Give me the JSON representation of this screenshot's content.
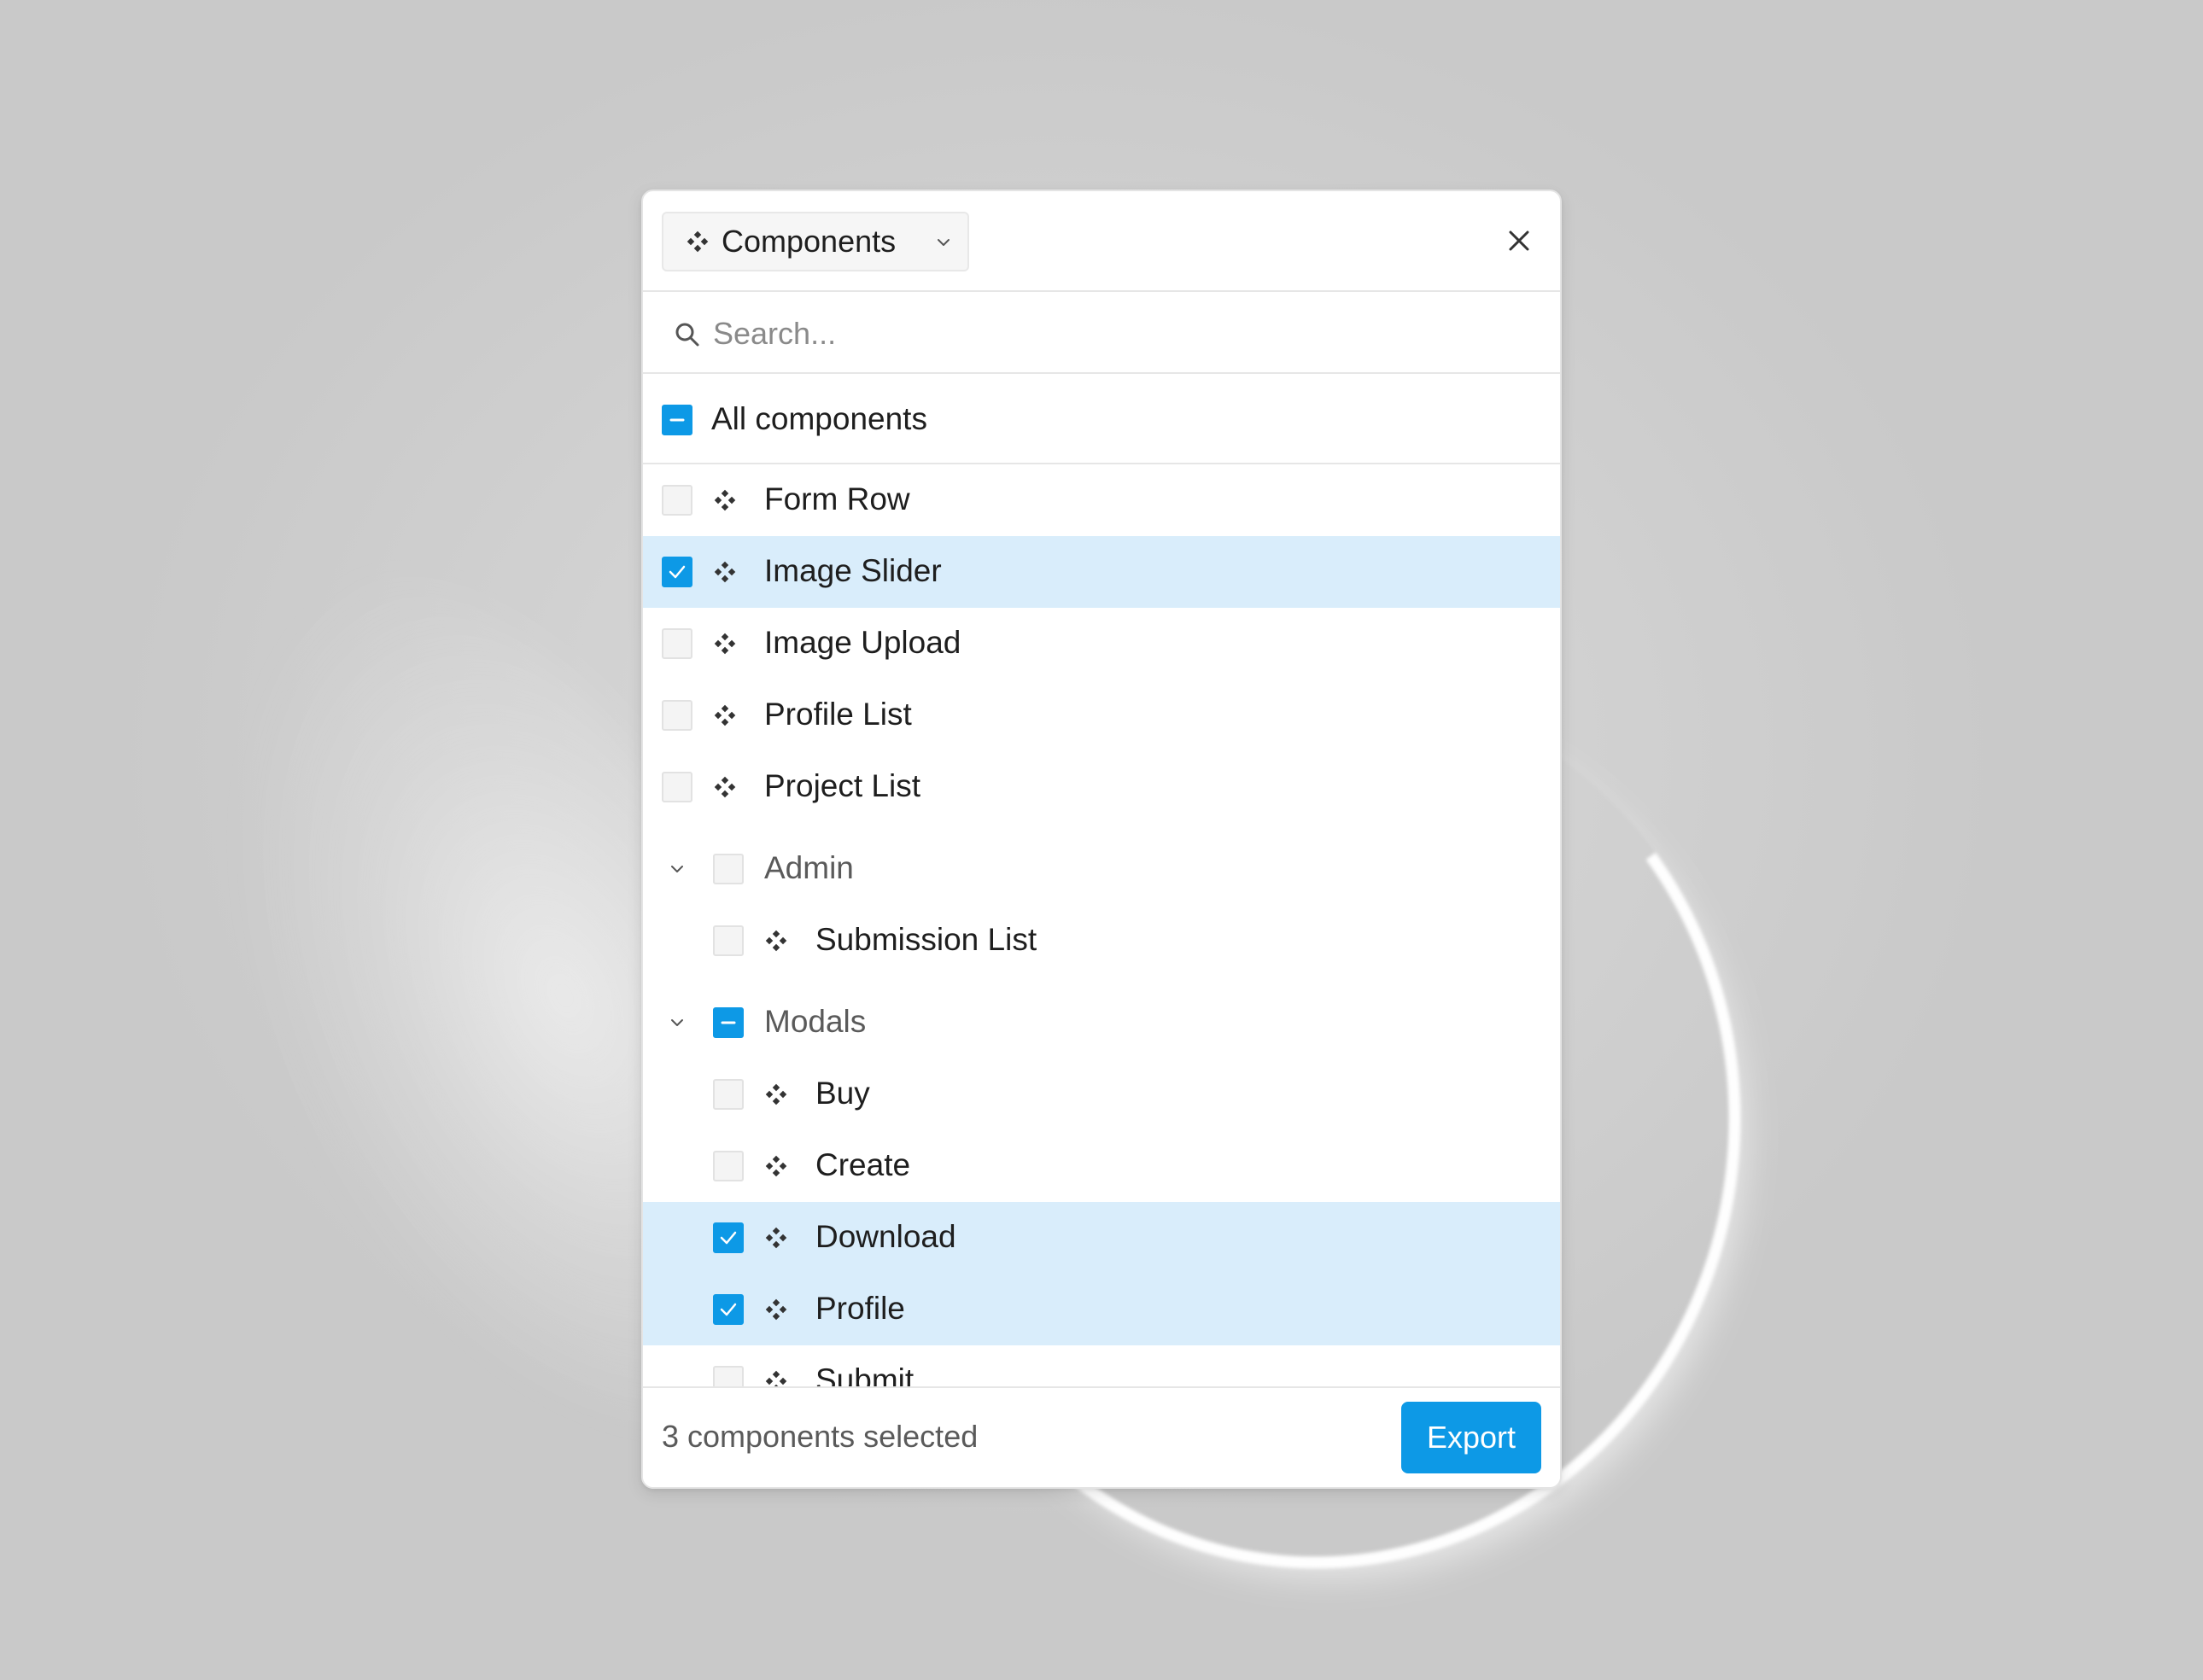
{
  "header": {
    "dropdown_label": "Components",
    "dropdown_icon": "component-icon",
    "close_icon": "close-icon"
  },
  "search": {
    "placeholder": "Search...",
    "value": ""
  },
  "all_components": {
    "label": "All components",
    "state": "mixed"
  },
  "items": [
    {
      "label": "Form Row",
      "checked": false
    },
    {
      "label": "Image Slider",
      "checked": true
    },
    {
      "label": "Image Upload",
      "checked": false
    },
    {
      "label": "Profile List",
      "checked": false
    },
    {
      "label": "Project List",
      "checked": false
    }
  ],
  "groups": [
    {
      "label": "Admin",
      "expanded": true,
      "state": "empty",
      "items": [
        {
          "label": "Submission List",
          "checked": false
        }
      ]
    },
    {
      "label": "Modals",
      "expanded": true,
      "state": "mixed",
      "items": [
        {
          "label": "Buy",
          "checked": false
        },
        {
          "label": "Create",
          "checked": false
        },
        {
          "label": "Download",
          "checked": true
        },
        {
          "label": "Profile",
          "checked": true
        },
        {
          "label": "Submit",
          "checked": false
        }
      ]
    }
  ],
  "footer": {
    "status": "3 components selected",
    "export_label": "Export"
  },
  "colors": {
    "accent": "#0d99e6",
    "selected_row": "#d9edfb",
    "text": "#1e1e1e",
    "muted_text": "#5a5a5a"
  }
}
